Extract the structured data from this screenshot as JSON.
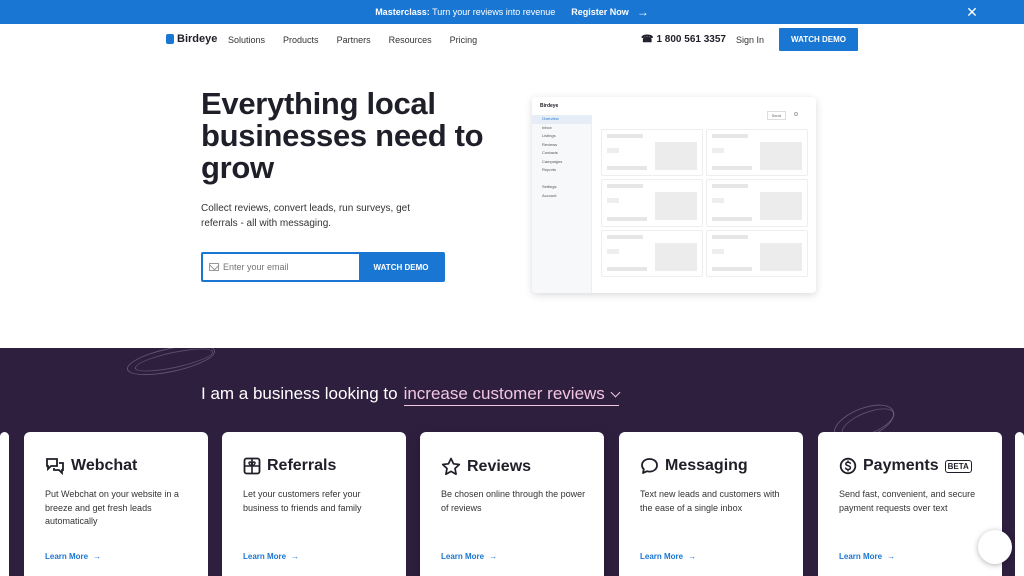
{
  "promo": {
    "strong": "Masterclass:",
    "text": " Turn your reviews into revenue",
    "cta": "Register Now",
    "arrow": "→",
    "close": "✕"
  },
  "nav": {
    "brand": "Birdeye",
    "items": [
      "Solutions",
      "Products",
      "Partners",
      "Resources",
      "Pricing"
    ],
    "phone_icon": "☎",
    "phone": "1 800 561 3357",
    "signin": "Sign In",
    "demo": "WATCH DEMO"
  },
  "hero": {
    "title": "Everything local businesses need to grow",
    "subtitle": "Collect reviews, convert leads, run surveys, get referrals - all with messaging.",
    "email_placeholder": "Enter your email",
    "button": "WATCH DEMO"
  },
  "mock": {
    "brand": "Birdeye",
    "side": [
      "Overview",
      "Inbox",
      "Listings",
      "Reviews",
      "Contacts",
      "Campaigns",
      "Reports",
      "",
      "Settings",
      "Account"
    ],
    "button": "Send"
  },
  "section": {
    "prefix": "I am a business looking to",
    "selected": "increase customer reviews"
  },
  "cards": [
    {
      "title": "Webchat",
      "desc": "Put Webchat on your website in a breeze and get fresh leads automatically",
      "link": "Learn More"
    },
    {
      "title": "Referrals",
      "desc": "Let your customers refer your business to friends and family",
      "link": "Learn More"
    },
    {
      "title": "Reviews",
      "desc": "Be chosen online through the power of reviews",
      "link": "Learn More"
    },
    {
      "title": "Messaging",
      "desc": "Text new leads and customers with the ease of a single inbox",
      "link": "Learn More"
    },
    {
      "title": "Payments",
      "badge": "BETA",
      "desc": "Send fast, convenient, and secure payment requests over text",
      "link": "Learn More"
    }
  ],
  "arrow": "→",
  "colors": {
    "accent": "#1976d2",
    "section_bg": "#2e1f3f",
    "highlight": "#f2c6e0"
  }
}
